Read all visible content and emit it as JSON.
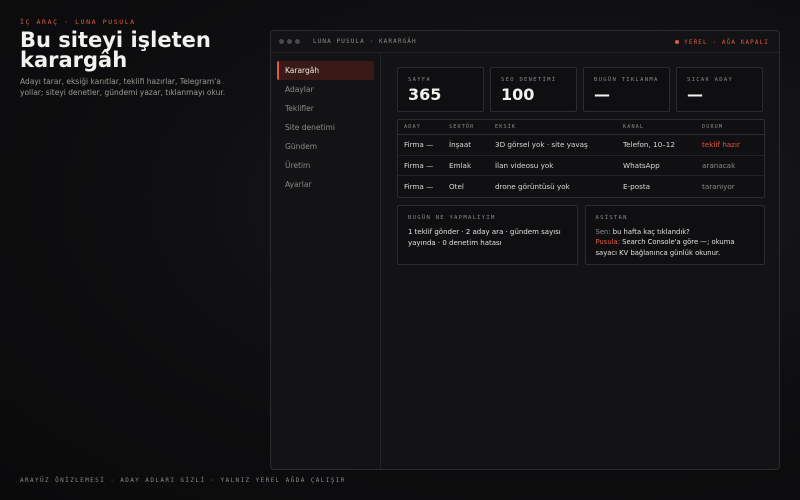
{
  "hero": {
    "eyebrow": "İÇ ARAÇ · LUNA PUSULA",
    "title": "Bu siteyi işleten karargâh",
    "description": "Adayı tarar, eksiği kanıtlar, teklifi hazırlar, Telegram'a yollar; siteyi denetler, gündemi yazar, tıklanmayı okur."
  },
  "footer": "ARAYÜZ ÖNİZLEMESİ · ADAY ADLARI GİZLİ · YALNIZ YEREL AĞDA ÇALIŞIR",
  "window": {
    "title": "LUNA PUSULA · KARARGÂH",
    "status": "YEREL · AĞA KAPALI"
  },
  "sidebar": {
    "items": [
      {
        "label": "Karargâh",
        "active": true
      },
      {
        "label": "Adaylar",
        "active": false
      },
      {
        "label": "Teklifler",
        "active": false
      },
      {
        "label": "Site denetimi",
        "active": false
      },
      {
        "label": "Gündem",
        "active": false
      },
      {
        "label": "Üretim",
        "active": false
      },
      {
        "label": "Ayarlar",
        "active": false
      }
    ]
  },
  "stats": [
    {
      "label": "SAYFA",
      "value": "365"
    },
    {
      "label": "SEO DENETİMİ",
      "value": "100"
    },
    {
      "label": "BUGÜN TIKLANMA",
      "value": "—"
    },
    {
      "label": "SICAK ADAY",
      "value": "—"
    }
  ],
  "table": {
    "headers": [
      "ADAY",
      "SEKTÖR",
      "EKSİK",
      "KANAL",
      "DURUM"
    ],
    "rows": [
      [
        "Firma —",
        "İnşaat",
        "3D görsel yok · site yavaş",
        "Telefon, 10–12",
        "teklif hazır"
      ],
      [
        "Firma —",
        "Emlak",
        "İlan videosu yok",
        "WhatsApp",
        "aranacak"
      ],
      [
        "Firma —",
        "Otel",
        "drone görüntüsü yok",
        "E-posta",
        "taranıyor"
      ]
    ]
  },
  "today": {
    "label": "BUGÜN NE YAPMALIYIM",
    "text": "1 teklif gönder · 2 aday ara · gündem sayısı yayında · 0 denetim hatası"
  },
  "assistant": {
    "label": "ASİSTAN",
    "you_prefix": "Sen:",
    "you_text": " bu hafta kaç tıklandık?",
    "bot_prefix": "Pusula:",
    "bot_text": " Search Console'a göre —; okuma sayacı KV bağlanınca günlük okunur."
  },
  "colors": {
    "accent": "#e0583e",
    "background": "#0e0e10",
    "panel": "#0f0f11"
  }
}
